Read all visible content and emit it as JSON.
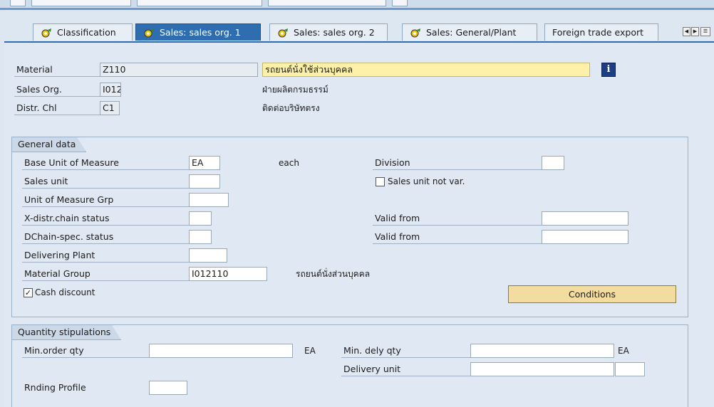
{
  "tabs": [
    {
      "label": "Classification",
      "active": false,
      "icon": "object-icon"
    },
    {
      "label": "Sales: sales org. 1",
      "active": true,
      "icon": "object-icon"
    },
    {
      "label": "Sales: sales org. 2",
      "active": false,
      "icon": "object-icon"
    },
    {
      "label": "Sales: General/Plant",
      "active": false,
      "icon": "object-icon"
    },
    {
      "label": "Foreign trade export",
      "active": false,
      "icon": "object-icon"
    }
  ],
  "header": {
    "material_label": "Material",
    "material_value": "Z110",
    "material_desc": "รถยนต์นั่งใช้ส่วนบุคคล",
    "salesorg_label": "Sales Org.",
    "salesorg_value": "I012",
    "salesorg_desc": "ฝ่ายผลิตกรมธรรม์",
    "distr_label": "Distr. Chl",
    "distr_value": "C1",
    "distr_desc": "ติดต่อบริษัทตรง"
  },
  "general": {
    "title": "General data",
    "base_uom_label": "Base Unit of Measure",
    "base_uom_value": "EA",
    "base_uom_text": "each",
    "division_label": "Division",
    "sales_unit_label": "Sales unit",
    "sales_unit_not_var_label": "Sales unit not var.",
    "uom_grp_label": "Unit of Measure Grp",
    "xdistr_label": "X-distr.chain status",
    "valid_from_label_1": "Valid from",
    "dchain_label": "DChain-spec. status",
    "valid_from_label_2": "Valid from",
    "delivering_plant_label": "Delivering Plant",
    "material_group_label": "Material Group",
    "material_group_value": "I012110",
    "material_group_text": "รถยนต์นั่งส่วนบุคคล",
    "cash_discount_label": "Cash discount",
    "cash_discount_checked": true,
    "conditions_label": "Conditions"
  },
  "quantity": {
    "title": "Quantity stipulations",
    "min_order_label": "Min.order qty",
    "min_order_unit": "EA",
    "min_dely_label": "Min. dely qty",
    "min_dely_unit": "EA",
    "delivery_unit_label": "Delivery unit",
    "rnding_label": "Rnding Profile"
  },
  "colors": {
    "active_tab": "#2f6db1",
    "highlight_field": "#fdf0a8",
    "button": "#f2dca0"
  }
}
